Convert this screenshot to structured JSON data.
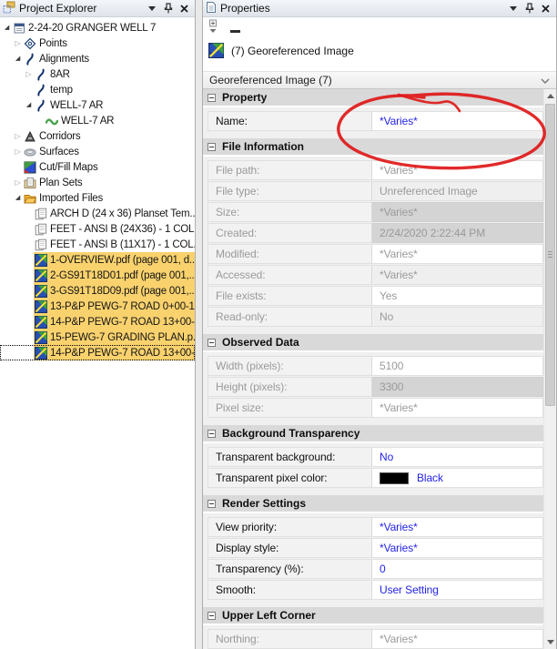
{
  "colors": {
    "selection_highlight": "#F9D26E",
    "editable_value_blue": "#2323E8",
    "readonly_gray": "#9A9A9A",
    "section_header_gray": "#D9D9D9",
    "annotation_red": "#E02020",
    "transparent_pixel_swatch": "#000000"
  },
  "icons": {
    "chevron-down": "window menu chevron",
    "pin": "auto-hide pushpin",
    "close": "close X",
    "project": "project root document",
    "points": "points diamond",
    "alignment": "alignment curve",
    "polyline": "green polyline",
    "corridor": "corridor A",
    "surface": "surface ellipse",
    "cutfill": "cut/fill color map",
    "planset": "plan sets folder",
    "folder": "imported files folder",
    "sheet": "planset template sheets",
    "georef": "georeferenced image",
    "pin-widget": "properties pin toggle",
    "page": "properties document",
    "combo-chevron": "combobox dropdown chevron"
  },
  "left_panel": {
    "title": "Project Explorer",
    "tree": [
      {
        "label": "2-24-20 GRANGER WELL 7",
        "icon": "project",
        "level": 0,
        "expand": "expanded"
      },
      {
        "label": "Points",
        "icon": "points",
        "level": 1,
        "expand": "collapsed"
      },
      {
        "label": "Alignments",
        "icon": "alignment",
        "level": 1,
        "expand": "expanded"
      },
      {
        "label": "8AR",
        "icon": "alignment",
        "level": 2,
        "expand": "collapsed"
      },
      {
        "label": "temp",
        "icon": "alignment",
        "level": 2,
        "expand": "none"
      },
      {
        "label": "WELL-7 AR",
        "icon": "alignment",
        "level": 2,
        "expand": "expanded"
      },
      {
        "label": "WELL-7 AR",
        "icon": "polyline",
        "level": 3,
        "expand": "none"
      },
      {
        "label": "Corridors",
        "icon": "corridor",
        "level": 1,
        "expand": "collapsed"
      },
      {
        "label": "Surfaces",
        "icon": "surface",
        "level": 1,
        "expand": "collapsed"
      },
      {
        "label": "Cut/Fill Maps",
        "icon": "cutfill",
        "level": 1,
        "expand": "none"
      },
      {
        "label": "Plan Sets",
        "icon": "planset",
        "level": 1,
        "expand": "collapsed"
      },
      {
        "label": "Imported Files",
        "icon": "folder",
        "level": 1,
        "expand": "expanded"
      },
      {
        "label": "ARCH D (24 x 36) Planset Tem...",
        "icon": "sheet",
        "level": 2,
        "expand": "none"
      },
      {
        "label": "FEET - ANSI B (24X36) - 1 COL...",
        "icon": "sheet",
        "level": 2,
        "expand": "none"
      },
      {
        "label": "FEET - ANSI B (11X17) - 1 COL...",
        "icon": "sheet",
        "level": 2,
        "expand": "none"
      },
      {
        "label": "1-OVERVIEW.pdf  (page 001, d...",
        "icon": "georef",
        "level": 2,
        "expand": "none",
        "highlight": true
      },
      {
        "label": "2-GS91T18D01.pdf  (page 001,...",
        "icon": "georef",
        "level": 2,
        "expand": "none",
        "highlight": true
      },
      {
        "label": "3-GS91T18D09.pdf  (page 001,...",
        "icon": "georef",
        "level": 2,
        "expand": "none",
        "highlight": true
      },
      {
        "label": "13-P&P PEWG-7 ROAD 0+00-1...",
        "icon": "georef",
        "level": 2,
        "expand": "none",
        "highlight": true
      },
      {
        "label": "14-P&P PEWG-7 ROAD 13+00-...",
        "icon": "georef",
        "level": 2,
        "expand": "none",
        "highlight": true
      },
      {
        "label": "15-PEWG-7 GRADING PLAN.p...",
        "icon": "georef",
        "level": 2,
        "expand": "none",
        "highlight": true
      },
      {
        "label": "14-P&P PEWG-7 ROAD 13+00-...",
        "icon": "georef",
        "level": 2,
        "expand": "none",
        "highlight": true,
        "focused": true
      }
    ]
  },
  "right_panel": {
    "title": "Properties",
    "selection_header": "(7) Georeferenced Image",
    "type_selector": "Georeferenced Image (7)",
    "sections": [
      {
        "title": "Property",
        "rows": [
          {
            "label": "Name:",
            "value": "*Varies*",
            "style": "editable",
            "vbg": "white"
          }
        ]
      },
      {
        "title": "File Information",
        "rows": [
          {
            "label": "File path:",
            "value": "*Varies*",
            "style": "readonly",
            "vbg": "white"
          },
          {
            "label": "File type:",
            "value": "Unreferenced Image",
            "style": "readonly",
            "vbg": "light"
          },
          {
            "label": "Size:",
            "value": "*Varies*",
            "style": "readonly",
            "vbg": "dark"
          },
          {
            "label": "Created:",
            "value": "2/24/2020 2:22:44 PM",
            "style": "readonly",
            "vbg": "dark"
          },
          {
            "label": "Modified:",
            "value": "*Varies*",
            "style": "readonly",
            "vbg": "white"
          },
          {
            "label": "Accessed:",
            "value": "*Varies*",
            "style": "readonly",
            "vbg": "light"
          },
          {
            "label": "File exists:",
            "value": "Yes",
            "style": "readonly",
            "vbg": "white"
          },
          {
            "label": "Read-only:",
            "value": "No",
            "style": "readonly",
            "vbg": "light"
          }
        ]
      },
      {
        "title": "Observed Data",
        "rows": [
          {
            "label": "Width (pixels):",
            "value": "5100",
            "style": "readonly",
            "vbg": "white"
          },
          {
            "label": "Height (pixels):",
            "value": "3300",
            "style": "readonly",
            "vbg": "dark"
          },
          {
            "label": "Pixel size:",
            "value": "*Varies*",
            "style": "readonly",
            "vbg": "white"
          }
        ]
      },
      {
        "title": "Background Transparency",
        "rows": [
          {
            "label": "Transparent background:",
            "value": "No",
            "style": "editable",
            "vbg": "white"
          },
          {
            "label": "Transparent pixel color:",
            "value": "Black",
            "style": "editable",
            "vbg": "white",
            "swatch": "#000000"
          }
        ]
      },
      {
        "title": "Render Settings",
        "rows": [
          {
            "label": "View priority:",
            "value": "*Varies*",
            "style": "editable",
            "vbg": "white"
          },
          {
            "label": "Display style:",
            "value": "*Varies*",
            "style": "editable",
            "vbg": "white"
          },
          {
            "label": "Transparency (%):",
            "value": "0",
            "style": "editable",
            "vbg": "white"
          },
          {
            "label": "Smooth:",
            "value": "User Setting",
            "style": "editable",
            "vbg": "white"
          }
        ]
      },
      {
        "title": "Upper Left Corner",
        "rows": [
          {
            "label": "Northing:",
            "value": "*Varies*",
            "style": "readonly",
            "vbg": "white"
          }
        ]
      }
    ]
  }
}
